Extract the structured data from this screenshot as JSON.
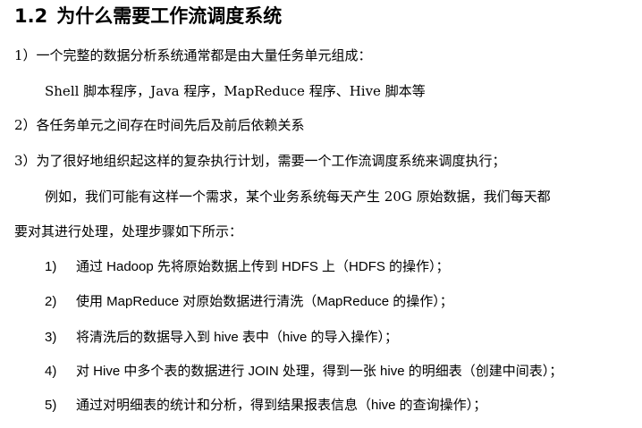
{
  "section": {
    "number": "1.2",
    "title": "为什么需要工作流调度系统"
  },
  "points": [
    "1）一个完整的数据分析系统通常都是由大量任务单元组成：",
    "Shell 脚本程序，Java 程序，MapReduce 程序、Hive 脚本等",
    "2）各任务单元之间存在时间先后及前后依赖关系",
    "3）为了很好地组织起这样的复杂执行计划，需要一个工作流调度系统来调度执行；"
  ],
  "example": {
    "line1": "例如，我们可能有这样一个需求，某个业务系统每天产生 20G 原始数据，我们每天都",
    "line2": "要对其进行处理，处理步骤如下所示："
  },
  "steps": [
    {
      "num": "1)",
      "text": "通过 Hadoop 先将原始数据上传到 HDFS 上（HDFS 的操作）；"
    },
    {
      "num": "2)",
      "text": "使用 MapReduce 对原始数据进行清洗（MapReduce 的操作）；"
    },
    {
      "num": "3)",
      "text": "将清洗后的数据导入到 hive 表中（hive 的导入操作）；"
    },
    {
      "num": "4)",
      "text": "对 Hive 中多个表的数据进行 JOIN 处理，得到一张 hive 的明细表（创建中间表）；"
    },
    {
      "num": "5)",
      "text": "通过对明细表的统计和分析，得到结果报表信息（hive 的查询操作）；"
    }
  ]
}
